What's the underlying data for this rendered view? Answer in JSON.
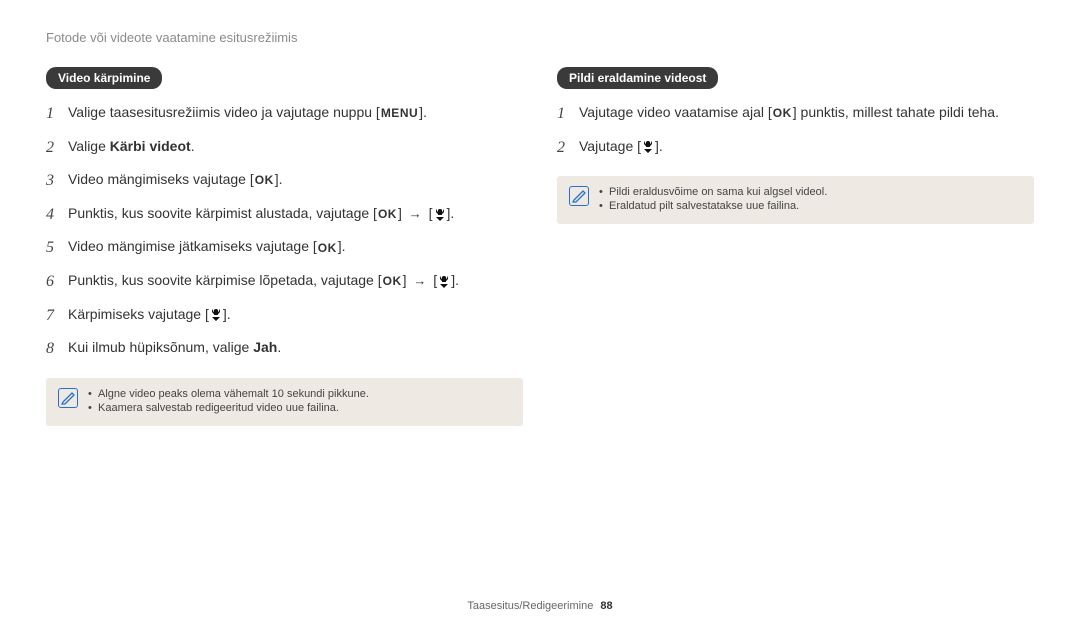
{
  "header": {
    "title": "Fotode või videote vaatamine esitusrežiimis"
  },
  "left": {
    "pill": "Video kärpimine",
    "steps": [
      {
        "n": "1",
        "parts": [
          {
            "t": "text",
            "v": "Valige taasesitusrežiimis video ja vajutage nuppu ["
          },
          {
            "t": "menu"
          },
          {
            "t": "text",
            "v": "]."
          }
        ]
      },
      {
        "n": "2",
        "parts": [
          {
            "t": "text",
            "v": "Valige "
          },
          {
            "t": "bold",
            "v": "Kärbi videot"
          },
          {
            "t": "text",
            "v": "."
          }
        ]
      },
      {
        "n": "3",
        "parts": [
          {
            "t": "text",
            "v": "Video mängimiseks vajutage ["
          },
          {
            "t": "ok"
          },
          {
            "t": "text",
            "v": "]."
          }
        ]
      },
      {
        "n": "4",
        "parts": [
          {
            "t": "text",
            "v": "Punktis, kus soovite kärpimist alustada, vajutage ["
          },
          {
            "t": "ok"
          },
          {
            "t": "text",
            "v": "] "
          },
          {
            "t": "arrow"
          },
          {
            "t": "text",
            "v": " ["
          },
          {
            "t": "macro"
          },
          {
            "t": "text",
            "v": "]."
          }
        ]
      },
      {
        "n": "5",
        "parts": [
          {
            "t": "text",
            "v": "Video mängimise jätkamiseks vajutage ["
          },
          {
            "t": "ok"
          },
          {
            "t": "text",
            "v": "]."
          }
        ]
      },
      {
        "n": "6",
        "parts": [
          {
            "t": "text",
            "v": "Punktis, kus soovite kärpimise lõpetada, vajutage ["
          },
          {
            "t": "ok"
          },
          {
            "t": "text",
            "v": "] "
          },
          {
            "t": "arrow"
          },
          {
            "t": "text",
            "v": " ["
          },
          {
            "t": "macro"
          },
          {
            "t": "text",
            "v": "]."
          }
        ]
      },
      {
        "n": "7",
        "parts": [
          {
            "t": "text",
            "v": "Kärpimiseks vajutage ["
          },
          {
            "t": "macro"
          },
          {
            "t": "text",
            "v": "]."
          }
        ]
      },
      {
        "n": "8",
        "parts": [
          {
            "t": "text",
            "v": "Kui ilmub hüpiksõnum, valige "
          },
          {
            "t": "bold",
            "v": "Jah"
          },
          {
            "t": "text",
            "v": "."
          }
        ]
      }
    ],
    "notes": [
      "Algne video peaks olema vähemalt 10 sekundi pikkune.",
      "Kaamera salvestab redigeeritud video uue failina."
    ]
  },
  "right": {
    "pill": "Pildi eraldamine videost",
    "steps": [
      {
        "n": "1",
        "parts": [
          {
            "t": "text",
            "v": "Vajutage video vaatamise ajal ["
          },
          {
            "t": "ok"
          },
          {
            "t": "text",
            "v": "] punktis, millest tahate pildi teha."
          }
        ]
      },
      {
        "n": "2",
        "parts": [
          {
            "t": "text",
            "v": "Vajutage ["
          },
          {
            "t": "macro"
          },
          {
            "t": "text",
            "v": "]."
          }
        ]
      }
    ],
    "notes": [
      "Pildi eraldusvõime on sama kui algsel videol.",
      "Eraldatud pilt salvestatakse uue failina."
    ]
  },
  "footer": {
    "section": "Taasesitus/Redigeerimine",
    "page": "88"
  },
  "icons": {
    "menu_label": "MENU",
    "ok_label": "OK"
  }
}
